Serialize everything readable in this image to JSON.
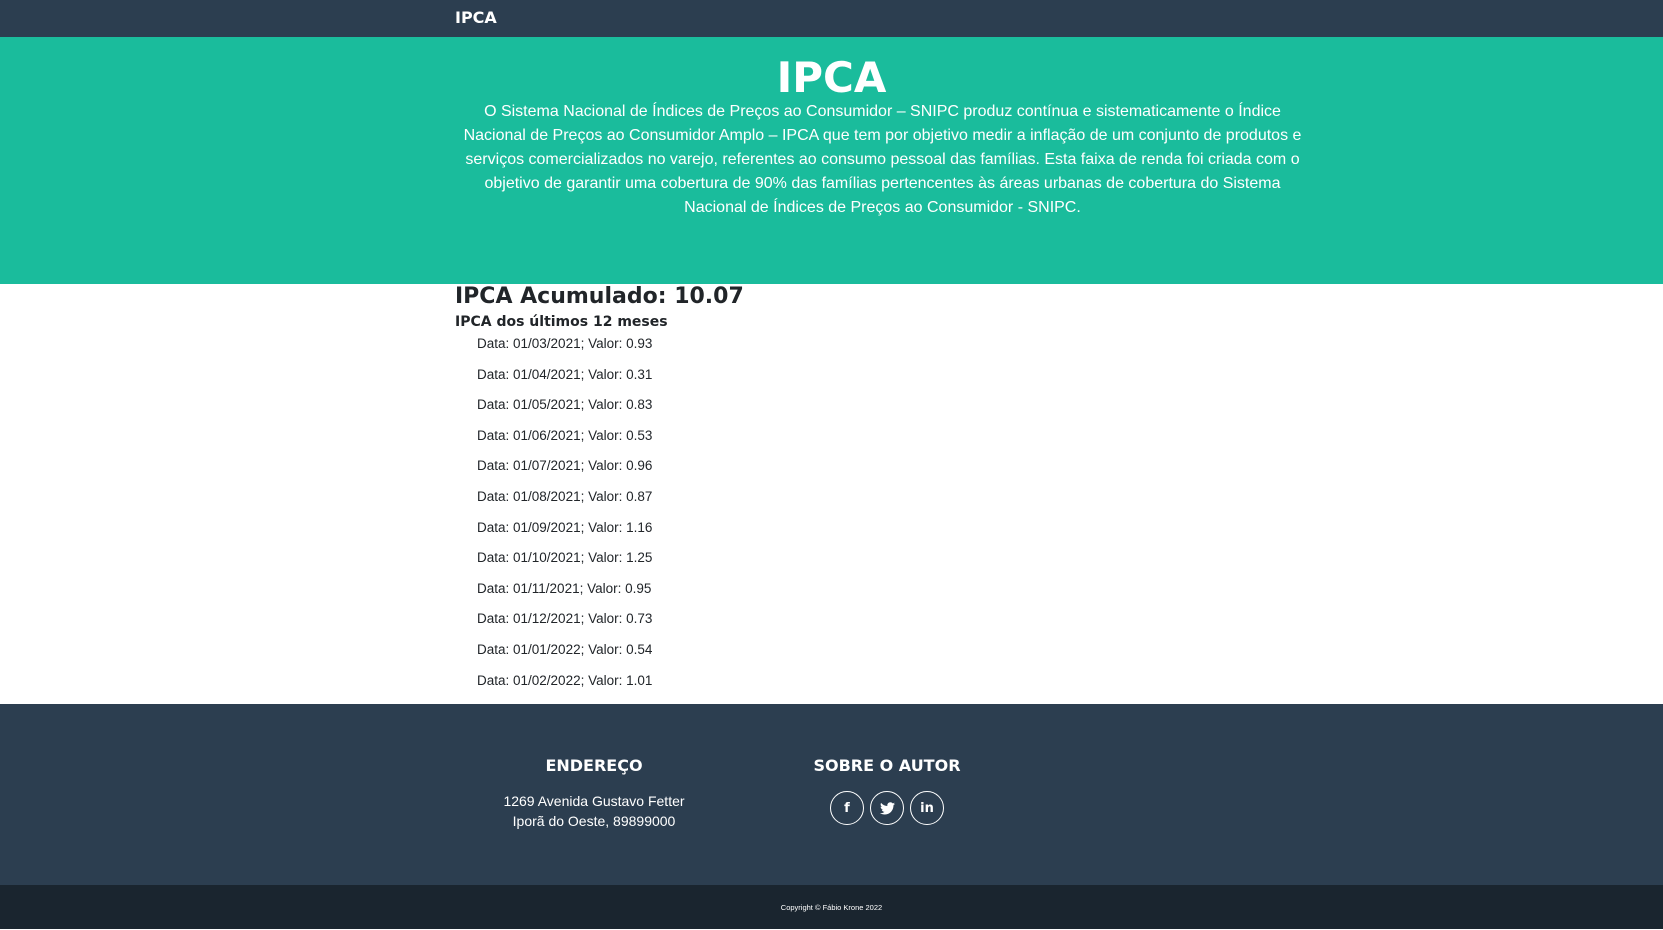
{
  "navbar": {
    "brand": "IPCA"
  },
  "hero": {
    "title": "IPCA",
    "description": "O Sistema Nacional de Índices de Preços ao Consumidor – SNIPC produz contínua e sistematicamente o Índice Nacional de Preços ao Consumidor Amplo – IPCA que tem por objetivo medir a inflação de um conjunto de produtos e serviços comercializados no varejo, referentes ao consumo pessoal das famílias. Esta faixa de renda foi criada com o objetivo de garantir uma cobertura de 90% das famílias pertencentes às áreas urbanas de cobertura do Sistema Nacional de Índices de Preços ao Consumidor - SNIPC."
  },
  "main": {
    "accumulated_label": "IPCA Acumulado:",
    "accumulated_value": "10.07",
    "subtitle": "IPCA dos últimos 12 meses",
    "entries": [
      "Data: 01/03/2021; Valor: 0.93",
      "Data: 01/04/2021; Valor: 0.31",
      "Data: 01/05/2021; Valor: 0.83",
      "Data: 01/06/2021; Valor: 0.53",
      "Data: 01/07/2021; Valor: 0.96",
      "Data: 01/08/2021; Valor: 0.87",
      "Data: 01/09/2021; Valor: 1.16",
      "Data: 01/10/2021; Valor: 1.25",
      "Data: 01/11/2021; Valor: 0.95",
      "Data: 01/12/2021; Valor: 0.73",
      "Data: 01/01/2022; Valor: 0.54",
      "Data: 01/02/2022; Valor: 1.01"
    ]
  },
  "footer": {
    "address_title": "ENDEREÇO",
    "address_line1": "1269 Avenida Gustavo Fetter",
    "address_line2": "Iporã do Oeste, 89899000",
    "about_title": "SOBRE O AUTOR",
    "socials": [
      {
        "icon": "facebook-icon",
        "glyph": "f"
      },
      {
        "icon": "twitter-icon",
        "glyph": "t"
      },
      {
        "icon": "linkedin-icon",
        "glyph": "in"
      }
    ]
  },
  "copyright": "Copyright © Fábio Krone 2022",
  "colors": {
    "navbar": "#2c3e50",
    "hero": "#1abc9c",
    "footer": "#2c3e50",
    "copyright": "#1a252f"
  }
}
